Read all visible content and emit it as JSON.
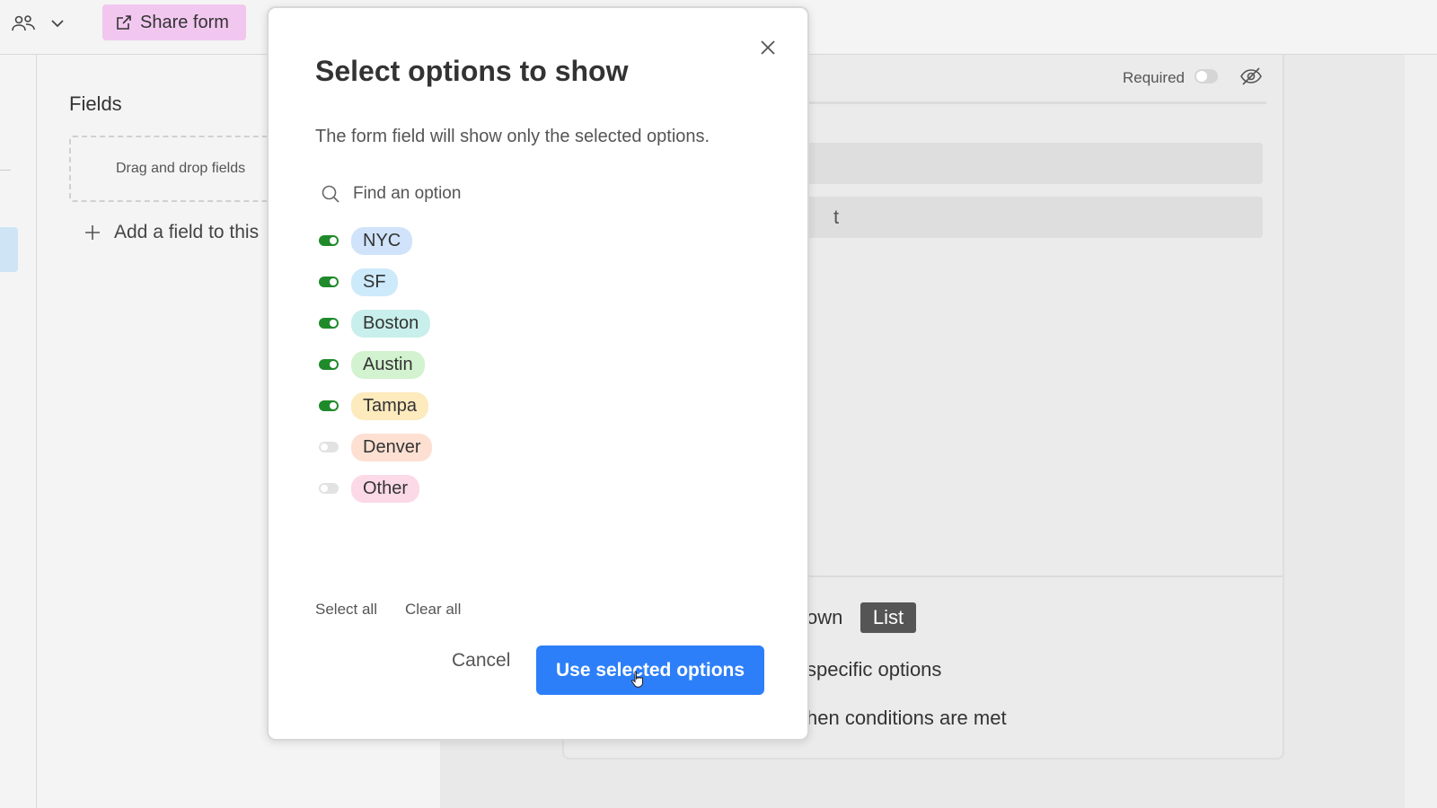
{
  "toolbar": {
    "share_label": "Share form"
  },
  "sidebar": {
    "title": "Fields",
    "dropzone_text": "Drag and drop fields",
    "add_field_label": "Add a field to this"
  },
  "field_card": {
    "required_label": "Required",
    "required_on": false,
    "partial_input_text": "t",
    "dropdown_partial": "own",
    "list_label": "List",
    "specific_options_partial": "specific options",
    "conditions_partial": "hen conditions are met"
  },
  "modal": {
    "title": "Select options to show",
    "description": "The form field will show only the selected options.",
    "search_placeholder": "Find an option",
    "options": [
      {
        "label": "NYC",
        "enabled": true,
        "color": "#d0e3fb"
      },
      {
        "label": "SF",
        "enabled": true,
        "color": "#cdeafb"
      },
      {
        "label": "Boston",
        "enabled": true,
        "color": "#c8efeb"
      },
      {
        "label": "Austin",
        "enabled": true,
        "color": "#d3f2cf"
      },
      {
        "label": "Tampa",
        "enabled": true,
        "color": "#fdeabd"
      },
      {
        "label": "Denver",
        "enabled": false,
        "color": "#fde0d2"
      },
      {
        "label": "Other",
        "enabled": false,
        "color": "#fcd9e6"
      }
    ],
    "select_all_label": "Select all",
    "clear_all_label": "Clear all",
    "cancel_label": "Cancel",
    "confirm_label": "Use selected options"
  },
  "colors": {
    "toggle_on": "#1f8a2a",
    "primary_button": "#2d7ff9",
    "share_button": "#f2c7ef"
  }
}
